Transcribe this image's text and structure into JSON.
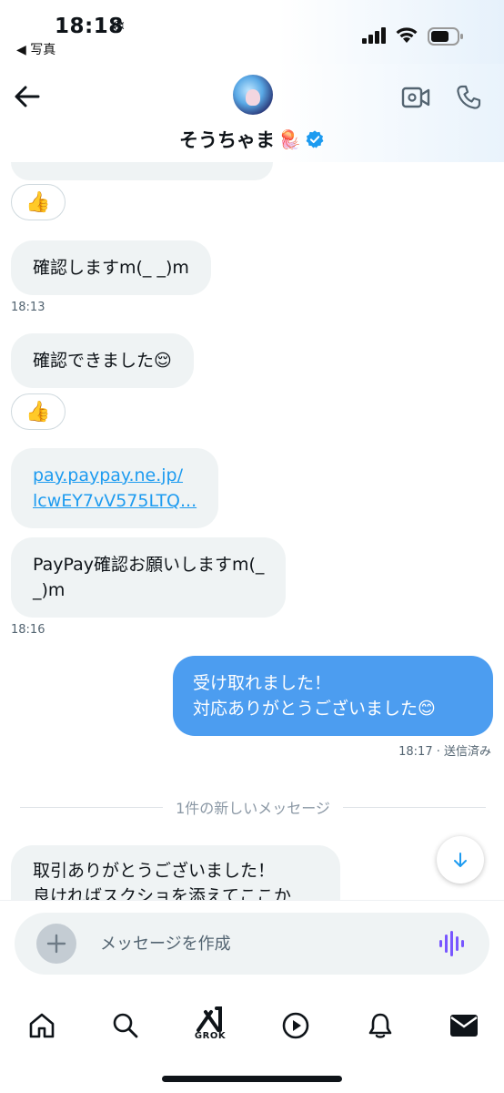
{
  "status_bar": {
    "time": "18:18",
    "snow_glyph": "❄",
    "back_app": "◀ 写真",
    "icons": [
      "signal-icon",
      "wifi-icon",
      "battery-icon"
    ]
  },
  "header": {
    "display_name": "そうちゃま",
    "name_emoji": "🪼",
    "verified": true,
    "icons": [
      "back-arrow-icon",
      "video-call-icon",
      "phone-icon",
      "verified-badge-icon"
    ]
  },
  "messages": {
    "reaction_emoji": "👍",
    "m1_text": "確認しますm(_ _)m",
    "m1_time": "18:13",
    "m2_text": "確認できました😌",
    "m3_link_line1": "pay.paypay.ne.jp/",
    "m3_link_line2": "lcwEY7vV575LTQ...",
    "m4_line1": "PayPay確認お願いしますm(_",
    "m4_line2": "_)m",
    "m4_time": "18:16",
    "out_line1": "受け取れました！",
    "out_line2": "対応ありがとうございました😊",
    "out_status": "18:17 · 送信済み",
    "divider_text": "1件の新しいメッセージ",
    "m5_line1": "取引ありがとうございました！",
    "m5_line2": "良ければスクショを添えてここか"
  },
  "composer": {
    "placeholder": "メッセージを作成"
  },
  "bottom_nav": {
    "grok_label": "GROK",
    "items": [
      "home-icon",
      "search-icon",
      "grok-icon",
      "video-icon",
      "notifications-icon",
      "messages-icon"
    ]
  },
  "colors": {
    "outgoing_bubble": "#4c9df0",
    "incoming_bubble": "#eff3f4",
    "link": "#1d9bf0",
    "verified": "#1d9bf0",
    "voice_icon": "#7856ff"
  }
}
